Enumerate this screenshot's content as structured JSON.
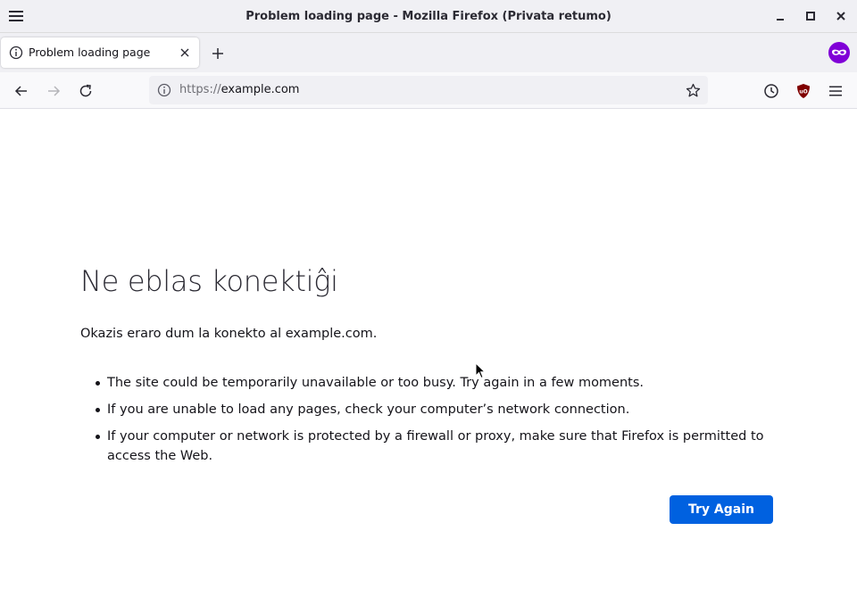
{
  "window": {
    "title": "Problem loading page - Mozilla Firefox (Privata retumo)"
  },
  "tabs": [
    {
      "label": "Problem loading page",
      "icon": "info-icon"
    }
  ],
  "navbar": {
    "url_scheme": "https://",
    "url_host": "example.com"
  },
  "error_page": {
    "title": "Ne eblas konektiĝi",
    "description": "Okazis eraro dum la konekto al example.com.",
    "suggestions": [
      "The site could be temporarily unavailable or too busy. Try again in a few moments.",
      "If you are unable to load any pages, check your computer’s network connection.",
      "If your computer or network is protected by a firewall or proxy, make sure that Firefox is permitted to access the Web."
    ],
    "button_label": "Try Again"
  },
  "colors": {
    "accent": "#0061e0",
    "private_purple": "#8000d7",
    "ublock_red": "#800000"
  }
}
